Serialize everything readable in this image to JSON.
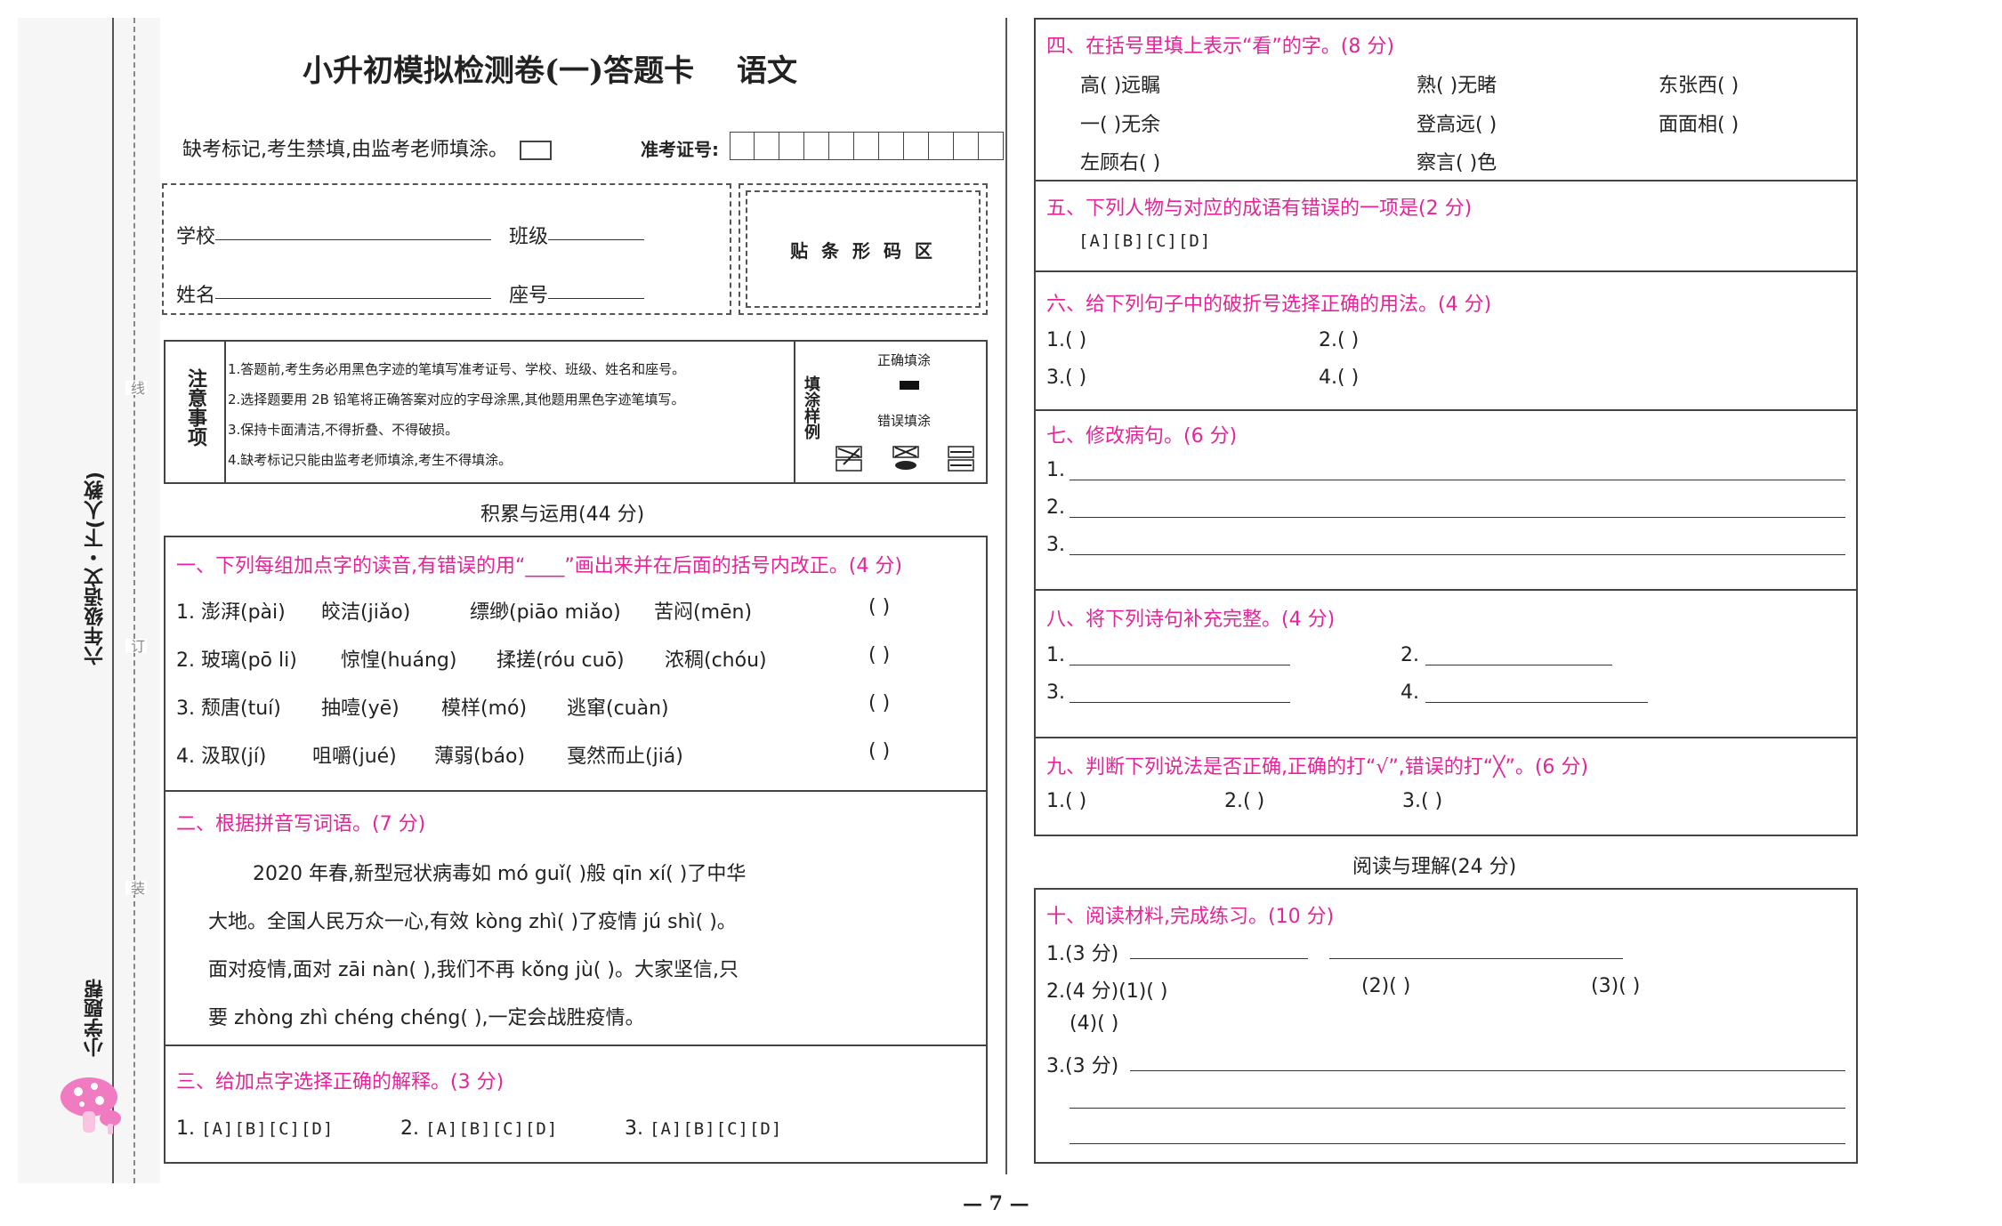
{
  "header": {
    "title": "小升初模拟检测卷(一)答题卡",
    "subject": "语文",
    "absent_mark": "缺考标记,考生禁填,由监考老师填涂。",
    "exam_number_label": "准考证号:",
    "barcode_area": "贴 条 形 码 区"
  },
  "student_info": {
    "school": "学校",
    "class": "班级",
    "name": "姓名",
    "seat": "座号"
  },
  "notes": {
    "label": "注意事项",
    "items": [
      "1.答题前,考生务必用黑色字迹的笔填写准考证号、学校、班级、姓名和座号。",
      "2.选择题要用 2B 铅笔将正确答案对应的字母涂黑,其他题用黑色字迹笔填写。",
      "3.保持卡面清洁,不得折叠、不得破损。",
      "4.缺考标记只能由监考老师填涂,考生不得填涂。"
    ],
    "fill_example_label": "填涂样例",
    "correct_fill": "正确填涂",
    "wrong_fill": "错误填涂"
  },
  "spine": {
    "grade": "六年级语文・下(人教)",
    "brand": "小学题帮",
    "marks": [
      "线",
      "订",
      "装"
    ]
  },
  "part1": {
    "title": "积累与运用(44 分)",
    "q1": {
      "title": "一、下列每组加点字的读音,有错误的用“____”画出来并在后面的括号内改正。(4 分)",
      "rows": [
        [
          "1.",
          "澎湃(pài)",
          "皎洁(jiǎo)",
          "缥缈(piāo miǎo)",
          "苦闷(mēn)"
        ],
        [
          "2.",
          "玻璃(pō li)",
          "惊惶(huáng)",
          "揉搓(róu cuō)",
          "浓稠(chóu)"
        ],
        [
          "3.",
          "颓唐(tuí)",
          "抽噎(yē)",
          "模样(mó)",
          "逃窜(cuàn)"
        ],
        [
          "4.",
          "汲取(jí)",
          "咀嚼(jué)",
          "薄弱(báo)",
          "戛然而止(jiá)"
        ]
      ],
      "paren": "(              )"
    },
    "q2": {
      "title": "二、根据拼音写词语。(7 分)",
      "lines": [
        "2020 年春,新型冠状病毒如 mó guǐ(            )般 qīn xí(            )了中华",
        "大地。全国人民万众一心,有效 kòng zhì(            )了疫情 jú shì(            )。",
        "面对疫情,面对 zāi nàn(            ),我们不再 kǒng jù(            )。大家坚信,只",
        "要 zhòng zhì chéng chéng(            ),一定会战胜疫情。"
      ]
    },
    "q3": {
      "title": "三、给加点字选择正确的解释。(3 分)",
      "items": [
        {
          "num": "1.",
          "opts": "[A][B][C][D]"
        },
        {
          "num": "2.",
          "opts": "[A][B][C][D]"
        },
        {
          "num": "3.",
          "opts": "[A][B][C][D]"
        }
      ]
    }
  },
  "right": {
    "q4": {
      "title": "四、在括号里填上表示“看”的字。(8 分)",
      "rows": [
        [
          "高(              )远瞩",
          "熟(              )无睹",
          "东张西(              )"
        ],
        [
          "一(              )无余",
          "登高远(              )",
          "面面相(              )"
        ],
        [
          "左顾右(              )",
          "察言(              )色",
          ""
        ]
      ]
    },
    "q5": {
      "title": "五、下列人物与对应的成语有错误的一项是(2 分)",
      "opts": "[A][B][C][D]"
    },
    "q6": {
      "title": "六、给下列句子中的破折号选择正确的用法。(4 分)",
      "items": [
        "1.(            )",
        "2.(            )",
        "3.(            )",
        "4.(            )"
      ]
    },
    "q7": {
      "title": "七、修改病句。(6 分)",
      "nums": [
        "1.",
        "2.",
        "3."
      ]
    },
    "q8": {
      "title": "八、将下列诗句补充完整。(4 分)",
      "nums": [
        "1.",
        "2.",
        "3.",
        "4."
      ]
    },
    "q9": {
      "title": "九、判断下列说法是否正确,正确的打“√”,错误的打“╳”。(6 分)",
      "items": [
        "1.(            )",
        "2.(            )",
        "3.(            )"
      ]
    },
    "part2_title": "阅读与理解(24 分)",
    "q10": {
      "title": "十、阅读材料,完成练习。(10 分)",
      "l1": "1.(3 分)",
      "l2": "2.(4 分)(1)(            )",
      "l2b": "(2)(            )",
      "l2c": "(3)(            )",
      "l3": "(4)(            )",
      "l4": "3.(3 分)"
    }
  },
  "footer": {
    "page": "— 7 —"
  }
}
